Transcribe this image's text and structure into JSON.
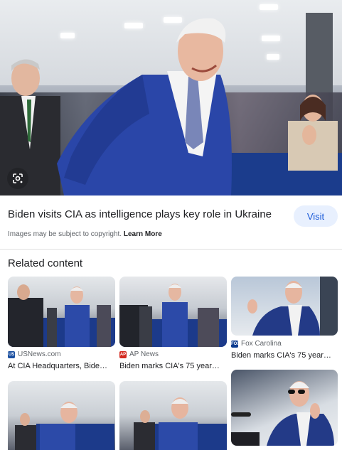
{
  "result": {
    "title": "Biden visits CIA as intelligence plays key role in Ukraine",
    "visit_label": "Visit",
    "copyright_text": "Images may be subject to copyright.",
    "learn_more": "Learn More"
  },
  "related": {
    "heading": "Related content",
    "items": [
      {
        "source": "USNews.com",
        "caption": "At CIA Headquarters, Bide…",
        "favicon_color": "#1a4fa0",
        "favicon_text": "US"
      },
      {
        "source": "AP News",
        "caption": "Biden marks CIA's 75 year…",
        "favicon_color": "#d42a20",
        "favicon_text": "AP"
      },
      {
        "source": "Fox Carolina",
        "caption": "Biden marks CIA's 75 year…",
        "favicon_color": "#0a3b8f",
        "favicon_text": "FOX"
      }
    ]
  },
  "colors": {
    "visit_bg": "#e8f0fe",
    "visit_text": "#1a5ad8",
    "table_blue": "#1b3c8c"
  }
}
